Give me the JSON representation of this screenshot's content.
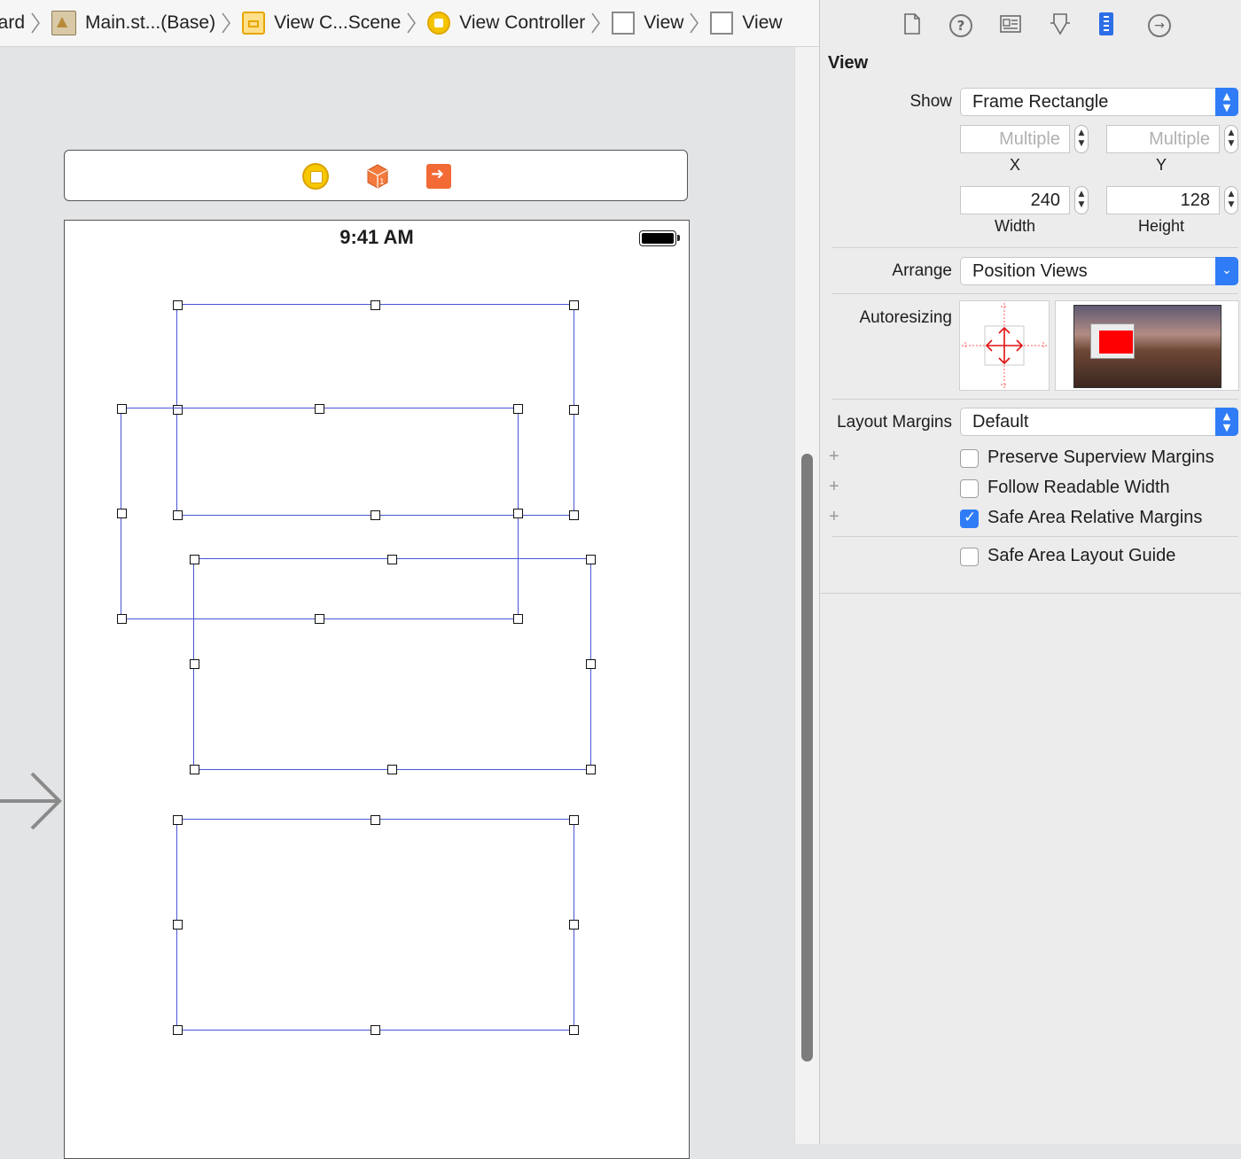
{
  "breadcrumb": [
    {
      "label": "oard",
      "icon": "none"
    },
    {
      "label": "Main.st...(Base)",
      "icon": "storyboard-file-icon"
    },
    {
      "label": "View C...Scene",
      "icon": "scene-icon"
    },
    {
      "label": "View Controller",
      "icon": "view-controller-icon"
    },
    {
      "label": "View",
      "icon": "view-icon"
    },
    {
      "label": "View",
      "icon": "view-icon"
    }
  ],
  "canvas": {
    "status_time": "9:41 AM"
  },
  "inspector": {
    "tabs": [
      "file-inspector-icon",
      "quick-help-icon",
      "identity-inspector-icon",
      "attributes-inspector-icon",
      "size-inspector-icon",
      "connections-inspector-icon"
    ],
    "active_tab": "size-inspector-icon",
    "section_title": "View",
    "show_label": "Show",
    "show_value": "Frame Rectangle",
    "x_placeholder": "Multiple",
    "y_placeholder": "Multiple",
    "x_label": "X",
    "y_label": "Y",
    "width_value": "240",
    "height_value": "128",
    "width_label": "Width",
    "height_label": "Height",
    "arrange_label": "Arrange",
    "arrange_value": "Position Views",
    "autoresizing_label": "Autoresizing",
    "layout_margins_label": "Layout Margins",
    "layout_margins_value": "Default",
    "checkboxes": [
      {
        "label": "Preserve Superview Margins",
        "checked": false
      },
      {
        "label": "Follow Readable Width",
        "checked": false
      },
      {
        "label": "Safe Area Relative Margins",
        "checked": true
      },
      {
        "label": "Safe Area Layout Guide",
        "checked": false
      }
    ],
    "accent_color": "#2f7cf6"
  },
  "colors": {
    "selection_border": "#4a55d6",
    "autoresize_red": "#ff0000"
  }
}
